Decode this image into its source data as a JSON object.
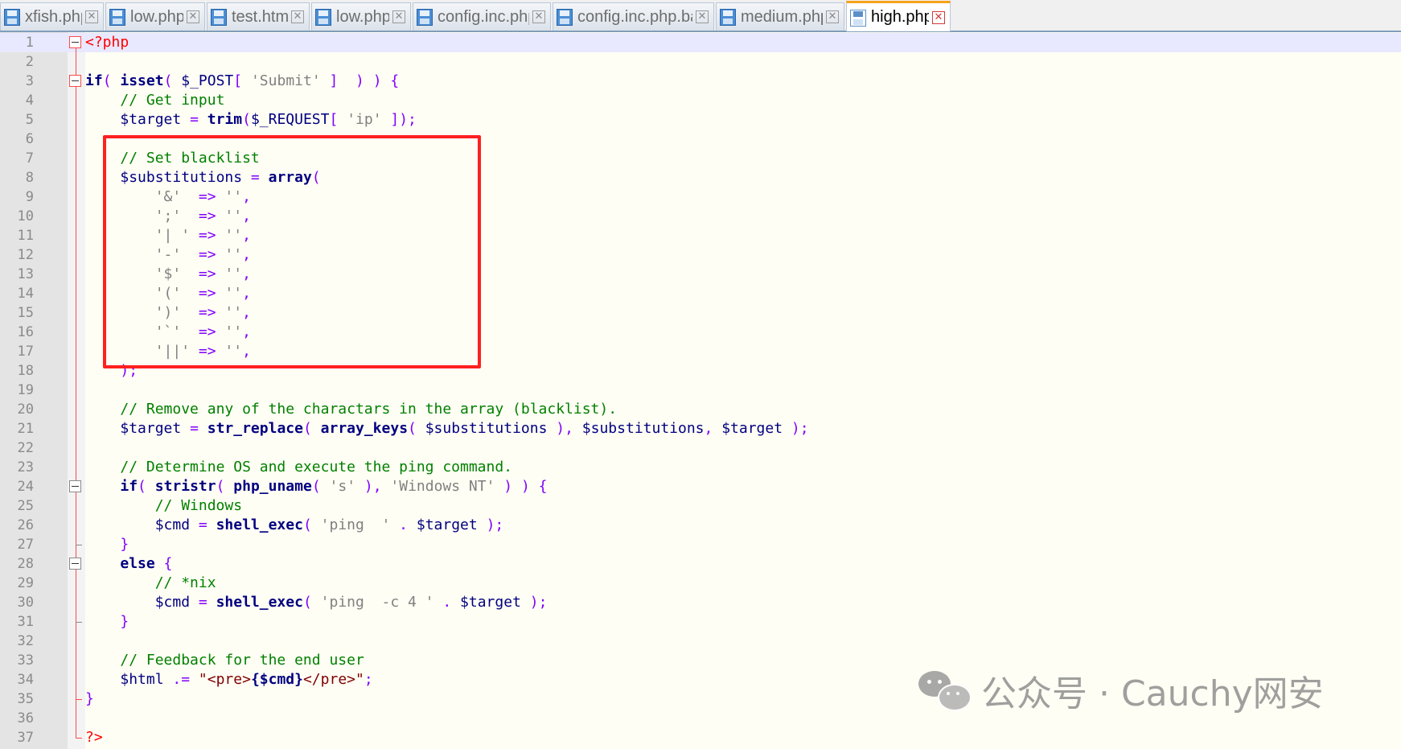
{
  "tabs": [
    {
      "name": "xfish.php",
      "close": "✕"
    },
    {
      "name": "low.php",
      "close": "✕"
    },
    {
      "name": "test.html",
      "close": "✕"
    },
    {
      "name": "low.php",
      "close": "✕"
    },
    {
      "name": "config.inc.php",
      "close": "✕"
    },
    {
      "name": "config.inc.php.bak",
      "close": "✕"
    },
    {
      "name": "medium.php",
      "close": "✕"
    },
    {
      "name": "high.php",
      "close": "✕",
      "active": true
    }
  ],
  "lines": [
    [
      [
        "tag",
        "<?php"
      ]
    ],
    [],
    [
      [
        "kw",
        "if"
      ],
      [
        "op",
        "( "
      ],
      [
        "kw",
        "isset"
      ],
      [
        "op",
        "( "
      ],
      [
        "var",
        "$_POST"
      ],
      [
        "op",
        "[ "
      ],
      [
        "str",
        "'Submit'"
      ],
      [
        "op",
        " ]  ) ) {"
      ]
    ],
    [
      [
        "txt",
        "    "
      ],
      [
        "cmt",
        "// Get input"
      ]
    ],
    [
      [
        "txt",
        "    "
      ],
      [
        "var",
        "$target "
      ],
      [
        "op",
        "= "
      ],
      [
        "kw",
        "trim"
      ],
      [
        "op",
        "("
      ],
      [
        "var",
        "$_REQUEST"
      ],
      [
        "op",
        "[ "
      ],
      [
        "str",
        "'ip'"
      ],
      [
        "op",
        " ]);"
      ]
    ],
    [],
    [
      [
        "txt",
        "    "
      ],
      [
        "cmt",
        "// Set blacklist"
      ]
    ],
    [
      [
        "txt",
        "    "
      ],
      [
        "var",
        "$substitutions "
      ],
      [
        "op",
        "= "
      ],
      [
        "kw",
        "array"
      ],
      [
        "op",
        "("
      ]
    ],
    [
      [
        "txt",
        "        "
      ],
      [
        "str",
        "'&'  "
      ],
      [
        "op",
        "=> "
      ],
      [
        "str",
        "''"
      ],
      [
        "op",
        ","
      ]
    ],
    [
      [
        "txt",
        "        "
      ],
      [
        "str",
        "';'  "
      ],
      [
        "op",
        "=> "
      ],
      [
        "str",
        "''"
      ],
      [
        "op",
        ","
      ]
    ],
    [
      [
        "txt",
        "        "
      ],
      [
        "str",
        "'| ' "
      ],
      [
        "op",
        "=> "
      ],
      [
        "str",
        "''"
      ],
      [
        "op",
        ","
      ]
    ],
    [
      [
        "txt",
        "        "
      ],
      [
        "str",
        "'-'  "
      ],
      [
        "op",
        "=> "
      ],
      [
        "str",
        "''"
      ],
      [
        "op",
        ","
      ]
    ],
    [
      [
        "txt",
        "        "
      ],
      [
        "str",
        "'$'  "
      ],
      [
        "op",
        "=> "
      ],
      [
        "str",
        "''"
      ],
      [
        "op",
        ","
      ]
    ],
    [
      [
        "txt",
        "        "
      ],
      [
        "str",
        "'('  "
      ],
      [
        "op",
        "=> "
      ],
      [
        "str",
        "''"
      ],
      [
        "op",
        ","
      ]
    ],
    [
      [
        "txt",
        "        "
      ],
      [
        "str",
        "')'  "
      ],
      [
        "op",
        "=> "
      ],
      [
        "str",
        "''"
      ],
      [
        "op",
        ","
      ]
    ],
    [
      [
        "txt",
        "        "
      ],
      [
        "str",
        "'`'  "
      ],
      [
        "op",
        "=> "
      ],
      [
        "str",
        "''"
      ],
      [
        "op",
        ","
      ]
    ],
    [
      [
        "txt",
        "        "
      ],
      [
        "str",
        "'||' "
      ],
      [
        "op",
        "=> "
      ],
      [
        "str",
        "''"
      ],
      [
        "op",
        ","
      ]
    ],
    [
      [
        "txt",
        "    "
      ],
      [
        "op",
        ");"
      ]
    ],
    [],
    [
      [
        "txt",
        "    "
      ],
      [
        "cmt",
        "// Remove any of the charactars in the array (blacklist)."
      ]
    ],
    [
      [
        "txt",
        "    "
      ],
      [
        "var",
        "$target "
      ],
      [
        "op",
        "= "
      ],
      [
        "kw",
        "str_replace"
      ],
      [
        "op",
        "( "
      ],
      [
        "kw",
        "array_keys"
      ],
      [
        "op",
        "( "
      ],
      [
        "var",
        "$substitutions "
      ],
      [
        "op",
        "), "
      ],
      [
        "var",
        "$substitutions"
      ],
      [
        "op",
        ", "
      ],
      [
        "var",
        "$target "
      ],
      [
        "op",
        ");"
      ]
    ],
    [],
    [
      [
        "txt",
        "    "
      ],
      [
        "cmt",
        "// Determine OS and execute the ping command."
      ]
    ],
    [
      [
        "txt",
        "    "
      ],
      [
        "kw",
        "if"
      ],
      [
        "op",
        "( "
      ],
      [
        "kw",
        "stristr"
      ],
      [
        "op",
        "( "
      ],
      [
        "kw",
        "php_uname"
      ],
      [
        "op",
        "( "
      ],
      [
        "str",
        "'s'"
      ],
      [
        "op",
        " ), "
      ],
      [
        "str",
        "'Windows NT'"
      ],
      [
        "op",
        " ) ) {"
      ]
    ],
    [
      [
        "txt",
        "        "
      ],
      [
        "cmt",
        "// Windows"
      ]
    ],
    [
      [
        "txt",
        "        "
      ],
      [
        "var",
        "$cmd "
      ],
      [
        "op",
        "= "
      ],
      [
        "kw",
        "shell_exec"
      ],
      [
        "op",
        "( "
      ],
      [
        "str",
        "'ping  '"
      ],
      [
        "op",
        " . "
      ],
      [
        "var",
        "$target "
      ],
      [
        "op",
        ");"
      ]
    ],
    [
      [
        "txt",
        "    "
      ],
      [
        "op",
        "}"
      ]
    ],
    [
      [
        "txt",
        "    "
      ],
      [
        "kw",
        "else "
      ],
      [
        "op",
        "{"
      ]
    ],
    [
      [
        "txt",
        "        "
      ],
      [
        "cmt",
        "// *nix"
      ]
    ],
    [
      [
        "txt",
        "        "
      ],
      [
        "var",
        "$cmd "
      ],
      [
        "op",
        "= "
      ],
      [
        "kw",
        "shell_exec"
      ],
      [
        "op",
        "( "
      ],
      [
        "str",
        "'ping  -c 4 '"
      ],
      [
        "op",
        " . "
      ],
      [
        "var",
        "$target "
      ],
      [
        "op",
        ");"
      ]
    ],
    [
      [
        "txt",
        "    "
      ],
      [
        "op",
        "}"
      ]
    ],
    [],
    [
      [
        "txt",
        "    "
      ],
      [
        "cmt",
        "// Feedback for the end user"
      ]
    ],
    [
      [
        "txt",
        "    "
      ],
      [
        "var",
        "$html "
      ],
      [
        "op",
        ".= "
      ],
      [
        "html",
        "\"<pre>"
      ],
      [
        "kw",
        "{$cmd}"
      ],
      [
        "html",
        "</pre>\""
      ],
      [
        "op",
        ";"
      ]
    ],
    [
      [
        "op",
        "}"
      ]
    ],
    [],
    [
      [
        "tag",
        "?>"
      ]
    ]
  ],
  "watermark": {
    "text": "公众号 · Cauchy网安"
  },
  "colors": {
    "accent": "#f7a21b",
    "highlight_box": "#ff2020",
    "keyword": "#000080",
    "comment": "#008000",
    "string": "#808080",
    "operator": "#8000ff",
    "php_tag": "#ff0000"
  }
}
